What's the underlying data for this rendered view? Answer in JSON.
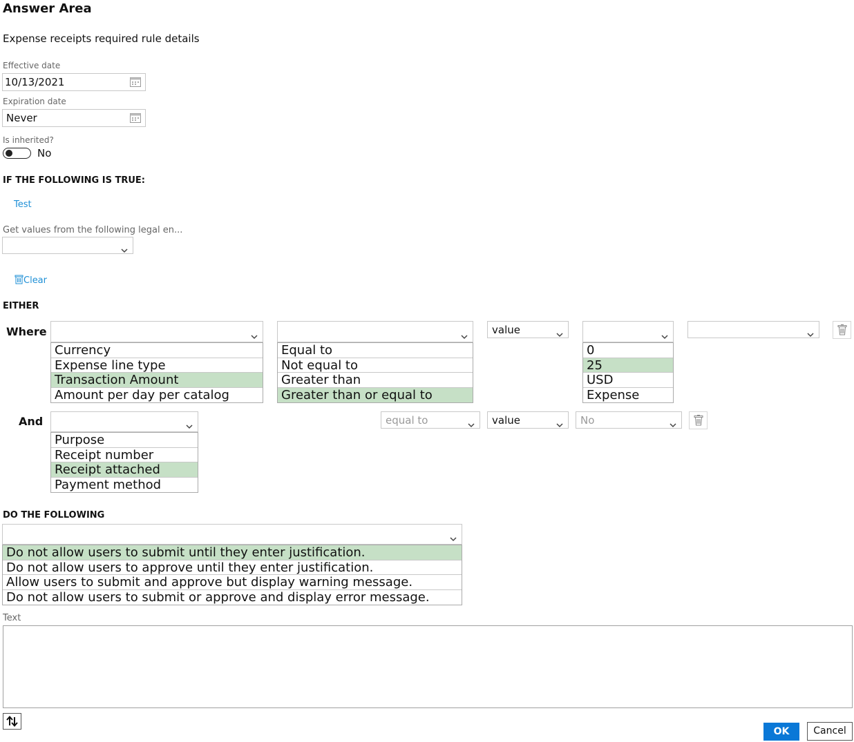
{
  "header": {
    "title": "Answer Area",
    "subtitle": "Expense receipts required rule details"
  },
  "form": {
    "effective_date_label": "Effective date",
    "effective_date_value": "10/13/2021",
    "expiration_date_label": "Expiration date",
    "expiration_date_value": "Never",
    "inherited_label": "Is inherited?",
    "inherited_value": "No",
    "inherited_on": false
  },
  "condition_section": {
    "heading": "IF THE FOLLOWING IS TRUE:",
    "test_link": "Test",
    "legal_entity_label": "Get values from the following legal en...",
    "clear_label": "Clear",
    "either_heading": "EITHER"
  },
  "where_row": {
    "label": "Where",
    "field_options": [
      "Currency",
      "Expense line type",
      "Transaction Amount",
      "Amount per day per catalog"
    ],
    "field_selected": "Transaction Amount",
    "operator_options": [
      "Equal to",
      "Not equal to",
      "Greater than",
      "Greater than or equal to"
    ],
    "operator_selected": "Greater than or equal to",
    "value_type": "value",
    "value_options": [
      "0",
      "25",
      "USD",
      "Expense"
    ],
    "value_selected": "25"
  },
  "and_row": {
    "label": "And",
    "field_options": [
      "Purpose",
      "Receipt number",
      "Receipt attached",
      "Payment method"
    ],
    "field_selected": "Receipt attached",
    "operator": "equal to",
    "value_type": "value",
    "value": "No"
  },
  "action_section": {
    "heading": "DO THE FOLLOWING",
    "action_options": [
      "Do not allow users to submit until they enter justification.",
      "Do not allow users to approve until they enter justification.",
      "Allow users to submit and approve but display warning message.",
      "Do not allow users to submit or approve and display error message."
    ],
    "action_selected": "Do not allow users to submit until they enter justification.",
    "text_label": "Text",
    "text_value": ""
  },
  "footer": {
    "ok_label": "OK",
    "cancel_label": "Cancel"
  },
  "colors": {
    "selected_option": "#c6e0c6",
    "link": "#1e8fd6",
    "primary_button": "#0a78d7"
  }
}
